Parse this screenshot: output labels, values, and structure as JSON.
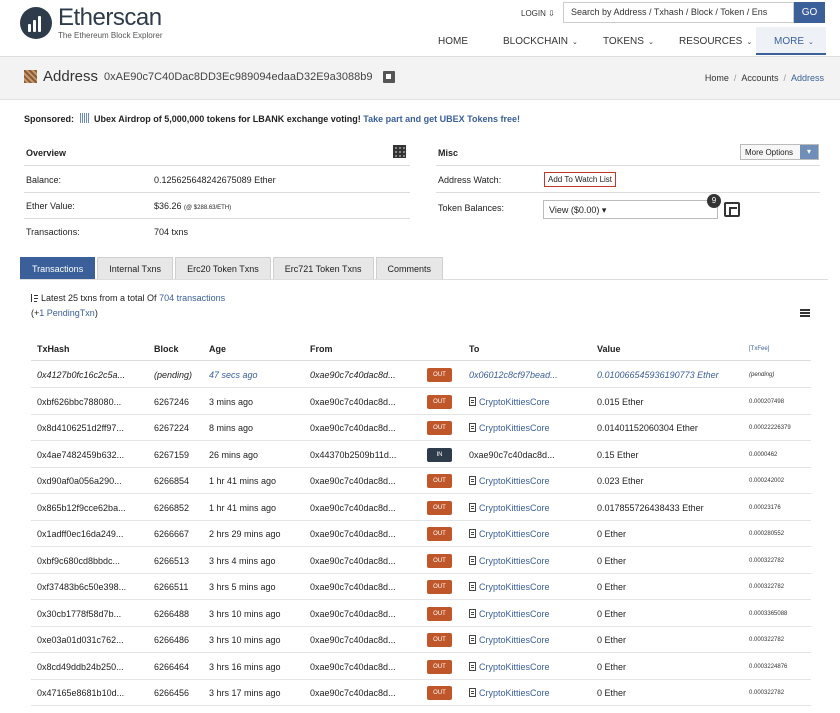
{
  "header": {
    "logo_title": "Etherscan",
    "logo_subtitle": "The Ethereum Block Explorer",
    "login": "LOGIN",
    "search_placeholder": "Search by Address / Txhash / Block / Token / Ens",
    "go": "GO",
    "nav": [
      "HOME",
      "BLOCKCHAIN",
      "TOKENS",
      "RESOURCES",
      "MORE"
    ]
  },
  "title": {
    "label": "Address",
    "hash": "0xAE90c7C40Dac8DD3Ec989094edaaD32E9a3088b9",
    "breadcrumb": [
      "Home",
      "Accounts",
      "Address"
    ]
  },
  "sponsored": {
    "label": "Sponsored:",
    "text": "Ubex Airdrop of 5,000,000 tokens for LBANK exchange voting!",
    "link": "Take part and get UBEX Tokens free!"
  },
  "overview": {
    "title": "Overview",
    "balance_label": "Balance:",
    "balance_value": "0.125625648242675089 Ether",
    "value_label": "Ether Value:",
    "value_amount": "$36.26",
    "value_rate": "(@ $288.63/ETH)",
    "txns_label": "Transactions:",
    "txns_value": "704 txns"
  },
  "misc": {
    "title": "Misc",
    "more_options": "More Options",
    "watch_label": "Address Watch:",
    "watch_button": "Add To Watch List",
    "tokens_label": "Token Balances:",
    "tokens_select": "View ($0.00)",
    "tokens_badge": "9"
  },
  "tabs": [
    "Transactions",
    "Internal Txns",
    "Erc20 Token Txns",
    "Erc721 Token Txns",
    "Comments"
  ],
  "summary": {
    "prefix": "Latest 25 txns from a total Of",
    "link": "704 transactions",
    "pending_open": "(+",
    "pending_link": "1 PendingTxn",
    "pending_close": ")"
  },
  "table": {
    "headers": [
      "TxHash",
      "Block",
      "Age",
      "From",
      "To",
      "Value",
      "[TxFee]"
    ],
    "rows": [
      {
        "hash": "0x4127b0fc16c2c5a...",
        "block": "(pending)",
        "age": "47 secs ago",
        "from": "0xae90c7c40dac8d...",
        "dir": "OUT",
        "to": "0x06012c8cf97bead...",
        "to_contract": false,
        "value": "0.010066545936190773 Ether",
        "fee": "(pending)",
        "pending": true
      },
      {
        "hash": "0xbf626bbc788080...",
        "block": "6267246",
        "age": "3 mins ago",
        "from": "0xae90c7c40dac8d...",
        "dir": "OUT",
        "to": "CryptoKittiesCore",
        "to_contract": true,
        "value": "0.015 Ether",
        "fee": "0.000207498"
      },
      {
        "hash": "0x8d4106251d2ff97...",
        "block": "6267224",
        "age": "8 mins ago",
        "from": "0xae90c7c40dac8d...",
        "dir": "OUT",
        "to": "CryptoKittiesCore",
        "to_contract": true,
        "value": "0.01401152060304 Ether",
        "fee": "0.00022226379"
      },
      {
        "hash": "0x4ae7482459b632...",
        "block": "6267159",
        "age": "26 mins ago",
        "from": "0x44370b2509b11d...",
        "dir": "IN",
        "to": "0xae90c7c40dac8d...",
        "to_contract": false,
        "to_plain": true,
        "value": "0.15 Ether",
        "fee": "0.0000462"
      },
      {
        "hash": "0xd90af0a056a290...",
        "block": "6266854",
        "age": "1 hr 41 mins ago",
        "from": "0xae90c7c40dac8d...",
        "dir": "OUT",
        "to": "CryptoKittiesCore",
        "to_contract": true,
        "value": "0.023 Ether",
        "fee": "0.000242002"
      },
      {
        "hash": "0x865b12f9cce62ba...",
        "block": "6266852",
        "age": "1 hr 41 mins ago",
        "from": "0xae90c7c40dac8d...",
        "dir": "OUT",
        "to": "CryptoKittiesCore",
        "to_contract": true,
        "value": "0.017855726438433 Ether",
        "fee": "0.00023176"
      },
      {
        "hash": "0x1adff0ec16da249...",
        "block": "6266667",
        "age": "2 hrs 29 mins ago",
        "from": "0xae90c7c40dac8d...",
        "dir": "OUT",
        "to": "CryptoKittiesCore",
        "to_contract": true,
        "value": "0 Ether",
        "fee": "0.000280552"
      },
      {
        "hash": "0xbf9c680cd8bbdc...",
        "block": "6266513",
        "age": "3 hrs 4 mins ago",
        "from": "0xae90c7c40dac8d...",
        "dir": "OUT",
        "to": "CryptoKittiesCore",
        "to_contract": true,
        "value": "0 Ether",
        "fee": "0.000322782"
      },
      {
        "hash": "0xf37483b6c50e398...",
        "block": "6266511",
        "age": "3 hrs 5 mins ago",
        "from": "0xae90c7c40dac8d...",
        "dir": "OUT",
        "to": "CryptoKittiesCore",
        "to_contract": true,
        "value": "0 Ether",
        "fee": "0.000322782"
      },
      {
        "hash": "0x30cb1778f58d7b...",
        "block": "6266488",
        "age": "3 hrs 10 mins ago",
        "from": "0xae90c7c40dac8d...",
        "dir": "OUT",
        "to": "CryptoKittiesCore",
        "to_contract": true,
        "value": "0 Ether",
        "fee": "0.0003365088"
      },
      {
        "hash": "0xe03a01d031c762...",
        "block": "6266486",
        "age": "3 hrs 10 mins ago",
        "from": "0xae90c7c40dac8d...",
        "dir": "OUT",
        "to": "CryptoKittiesCore",
        "to_contract": true,
        "value": "0 Ether",
        "fee": "0.000322782"
      },
      {
        "hash": "0x8cd49ddb24b250...",
        "block": "6266464",
        "age": "3 hrs 16 mins ago",
        "from": "0xae90c7c40dac8d...",
        "dir": "OUT",
        "to": "CryptoKittiesCore",
        "to_contract": true,
        "value": "0 Ether",
        "fee": "0.0003224876"
      },
      {
        "hash": "0x47165e8681b10d...",
        "block": "6266456",
        "age": "3 hrs 17 mins ago",
        "from": "0xae90c7c40dac8d...",
        "dir": "OUT",
        "to": "CryptoKittiesCore",
        "to_contract": true,
        "value": "0 Ether",
        "fee": "0.000322782"
      }
    ]
  },
  "colors": {
    "accent": "#3a5f99",
    "out_badge": "#c0572b",
    "in_badge": "#2e3b4a"
  }
}
